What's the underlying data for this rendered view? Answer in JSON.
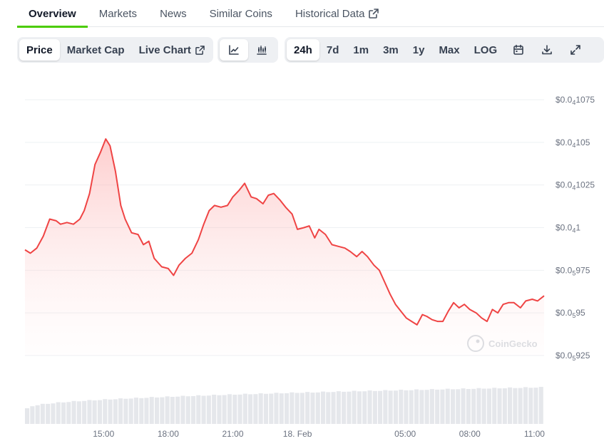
{
  "tabs": [
    {
      "label": "Overview",
      "active": true
    },
    {
      "label": "Markets",
      "active": false
    },
    {
      "label": "News",
      "active": false
    },
    {
      "label": "Similar Coins",
      "active": false
    },
    {
      "label": "Historical Data",
      "active": false,
      "external": true
    }
  ],
  "chart_type_buttons": [
    {
      "label": "Price",
      "active": true
    },
    {
      "label": "Market Cap",
      "active": false
    },
    {
      "label": "Live Chart",
      "active": false,
      "external": true
    }
  ],
  "view_buttons": [
    {
      "icon": "line-chart-icon",
      "active": true
    },
    {
      "icon": "candlestick-chart-icon",
      "active": false
    }
  ],
  "range_buttons": [
    {
      "label": "24h",
      "active": true
    },
    {
      "label": "7d",
      "active": false
    },
    {
      "label": "1m",
      "active": false
    },
    {
      "label": "3m",
      "active": false
    },
    {
      "label": "1y",
      "active": false
    },
    {
      "label": "Max",
      "active": false
    },
    {
      "label": "LOG",
      "active": false
    }
  ],
  "tool_icons": [
    "calendar-icon",
    "download-icon",
    "fullscreen-icon"
  ],
  "watermark": "CoinGecko",
  "colors": {
    "line": "#ef4444",
    "fill": "#fecaca",
    "accent_tab": "#4bcc00",
    "volume": "#e5e7eb"
  },
  "chart_data": {
    "type": "area",
    "x_ticks": [
      "15:00",
      "18:00",
      "21:00",
      "18. Feb",
      "05:00",
      "08:00",
      "11:00"
    ],
    "x_tick_hours": [
      15,
      18,
      21,
      24,
      29,
      32,
      35
    ],
    "x_range_hours": [
      11.35,
      35.45
    ],
    "y_ticks": [
      {
        "value": 1.075e-06,
        "prefix": "$0.0",
        "sub": "4",
        "suffix": "1075"
      },
      {
        "value": 1.05e-06,
        "prefix": "$0.0",
        "sub": "4",
        "suffix": "105"
      },
      {
        "value": 1.025e-06,
        "prefix": "$0.0",
        "sub": "4",
        "suffix": "1025"
      },
      {
        "value": 1e-06,
        "prefix": "$0.0",
        "sub": "4",
        "suffix": "1"
      },
      {
        "value": 9.75e-07,
        "prefix": "$0.0",
        "sub": "5",
        "suffix": "975"
      },
      {
        "value": 9.5e-07,
        "prefix": "$0.0",
        "sub": "5",
        "suffix": "95"
      },
      {
        "value": 9.25e-07,
        "prefix": "$0.0",
        "sub": "5",
        "suffix": "925"
      }
    ],
    "ylim": [
      9.25e-07,
      1.075e-06
    ],
    "grid": true,
    "series": [
      {
        "values": [
          [
            11.35,
            9.87e-07
          ],
          [
            11.6,
            9.85e-07
          ],
          [
            11.9,
            9.88e-07
          ],
          [
            12.2,
            9.95e-07
          ],
          [
            12.5,
            1.005e-06
          ],
          [
            12.8,
            1.004e-06
          ],
          [
            13.0,
            1.002e-06
          ],
          [
            13.3,
            1.003e-06
          ],
          [
            13.6,
            1.002e-06
          ],
          [
            13.9,
            1.005e-06
          ],
          [
            14.1,
            1.01e-06
          ],
          [
            14.35,
            1.02e-06
          ],
          [
            14.6,
            1.037e-06
          ],
          [
            14.85,
            1.044e-06
          ],
          [
            15.1,
            1.052e-06
          ],
          [
            15.3,
            1.048e-06
          ],
          [
            15.55,
            1.033e-06
          ],
          [
            15.8,
            1.013e-06
          ],
          [
            16.0,
            1.005e-06
          ],
          [
            16.3,
            9.97e-07
          ],
          [
            16.6,
            9.96e-07
          ],
          [
            16.85,
            9.9e-07
          ],
          [
            17.1,
            9.92e-07
          ],
          [
            17.35,
            9.82e-07
          ],
          [
            17.7,
            9.77e-07
          ],
          [
            18.0,
            9.76e-07
          ],
          [
            18.25,
            9.72e-07
          ],
          [
            18.5,
            9.78e-07
          ],
          [
            18.8,
            9.82e-07
          ],
          [
            19.1,
            9.85e-07
          ],
          [
            19.4,
            9.93e-07
          ],
          [
            19.65,
            1.002e-06
          ],
          [
            19.9,
            1.01e-06
          ],
          [
            20.15,
            1.013e-06
          ],
          [
            20.45,
            1.012e-06
          ],
          [
            20.75,
            1.013e-06
          ],
          [
            21.0,
            1.018e-06
          ],
          [
            21.3,
            1.022e-06
          ],
          [
            21.55,
            1.026e-06
          ],
          [
            21.85,
            1.018e-06
          ],
          [
            22.1,
            1.017e-06
          ],
          [
            22.4,
            1.014e-06
          ],
          [
            22.65,
            1.019e-06
          ],
          [
            22.9,
            1.02e-06
          ],
          [
            23.2,
            1.016e-06
          ],
          [
            23.45,
            1.012e-06
          ],
          [
            23.75,
            1.008e-06
          ],
          [
            24.0,
            9.99e-07
          ],
          [
            24.3,
            1e-06
          ],
          [
            24.55,
            1.001e-06
          ],
          [
            24.8,
            9.94e-07
          ],
          [
            25.0,
            9.99e-07
          ],
          [
            25.3,
            9.96e-07
          ],
          [
            25.6,
            9.9e-07
          ],
          [
            25.9,
            9.89e-07
          ],
          [
            26.2,
            9.88e-07
          ],
          [
            26.45,
            9.86e-07
          ],
          [
            26.75,
            9.83e-07
          ],
          [
            27.0,
            9.86e-07
          ],
          [
            27.25,
            9.83e-07
          ],
          [
            27.55,
            9.78e-07
          ],
          [
            27.8,
            9.75e-07
          ],
          [
            28.05,
            9.68e-07
          ],
          [
            28.3,
            9.61e-07
          ],
          [
            28.55,
            9.55e-07
          ],
          [
            28.8,
            9.51e-07
          ],
          [
            29.05,
            9.47e-07
          ],
          [
            29.3,
            9.45e-07
          ],
          [
            29.55,
            9.43e-07
          ],
          [
            29.8,
            9.49e-07
          ],
          [
            30.0,
            9.48e-07
          ],
          [
            30.25,
            9.46e-07
          ],
          [
            30.5,
            9.45e-07
          ],
          [
            30.75,
            9.45e-07
          ],
          [
            31.0,
            9.51e-07
          ],
          [
            31.25,
            9.56e-07
          ],
          [
            31.5,
            9.53e-07
          ],
          [
            31.75,
            9.55e-07
          ],
          [
            32.0,
            9.52e-07
          ],
          [
            32.3,
            9.5e-07
          ],
          [
            32.55,
            9.47e-07
          ],
          [
            32.8,
            9.45e-07
          ],
          [
            33.05,
            9.52e-07
          ],
          [
            33.3,
            9.5e-07
          ],
          [
            33.55,
            9.55e-07
          ],
          [
            33.8,
            9.56e-07
          ],
          [
            34.05,
            9.56e-07
          ],
          [
            34.35,
            9.53e-07
          ],
          [
            34.6,
            9.57e-07
          ],
          [
            34.9,
            9.58e-07
          ],
          [
            35.15,
            9.57e-07
          ],
          [
            35.45,
            9.6e-07
          ]
        ]
      }
    ]
  }
}
